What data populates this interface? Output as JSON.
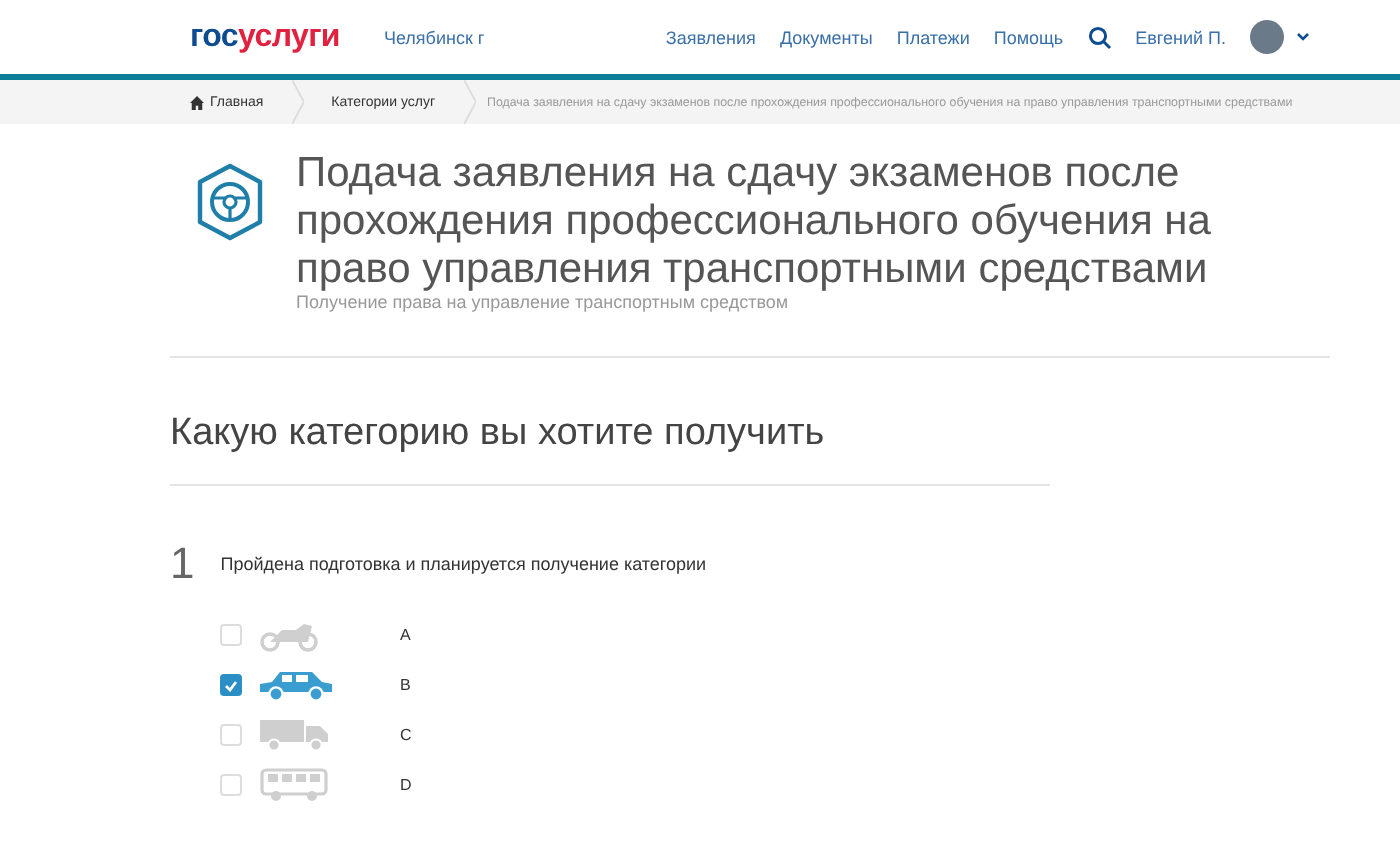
{
  "header": {
    "logo_parts": [
      "гос",
      "услуги"
    ],
    "city": "Челябинск г",
    "nav": [
      "Заявления",
      "Документы",
      "Платежи",
      "Помощь"
    ],
    "user": "Евгений П."
  },
  "breadcrumbs": [
    "Главная",
    "Категории услуг",
    "Подача заявления на сдачу экзаменов после прохождения профессионального обучения на право управления транспортными средствами"
  ],
  "service": {
    "title": "Подача заявления на сдачу экзаменов после прохождения профессионального обучения на право управления транспортными средствами",
    "subtitle": "Получение права на управление транспортным средством"
  },
  "section_title": "Какую категорию вы хотите получить",
  "question": {
    "number": "1",
    "text": "Пройдена подготовка и планируется получение категории",
    "options": [
      {
        "kind": "motorcycle",
        "label": "A",
        "checked": false
      },
      {
        "kind": "car",
        "label": "B",
        "checked": true
      },
      {
        "kind": "truck",
        "label": "C",
        "checked": false
      },
      {
        "kind": "bus",
        "label": "D",
        "checked": false
      }
    ]
  }
}
